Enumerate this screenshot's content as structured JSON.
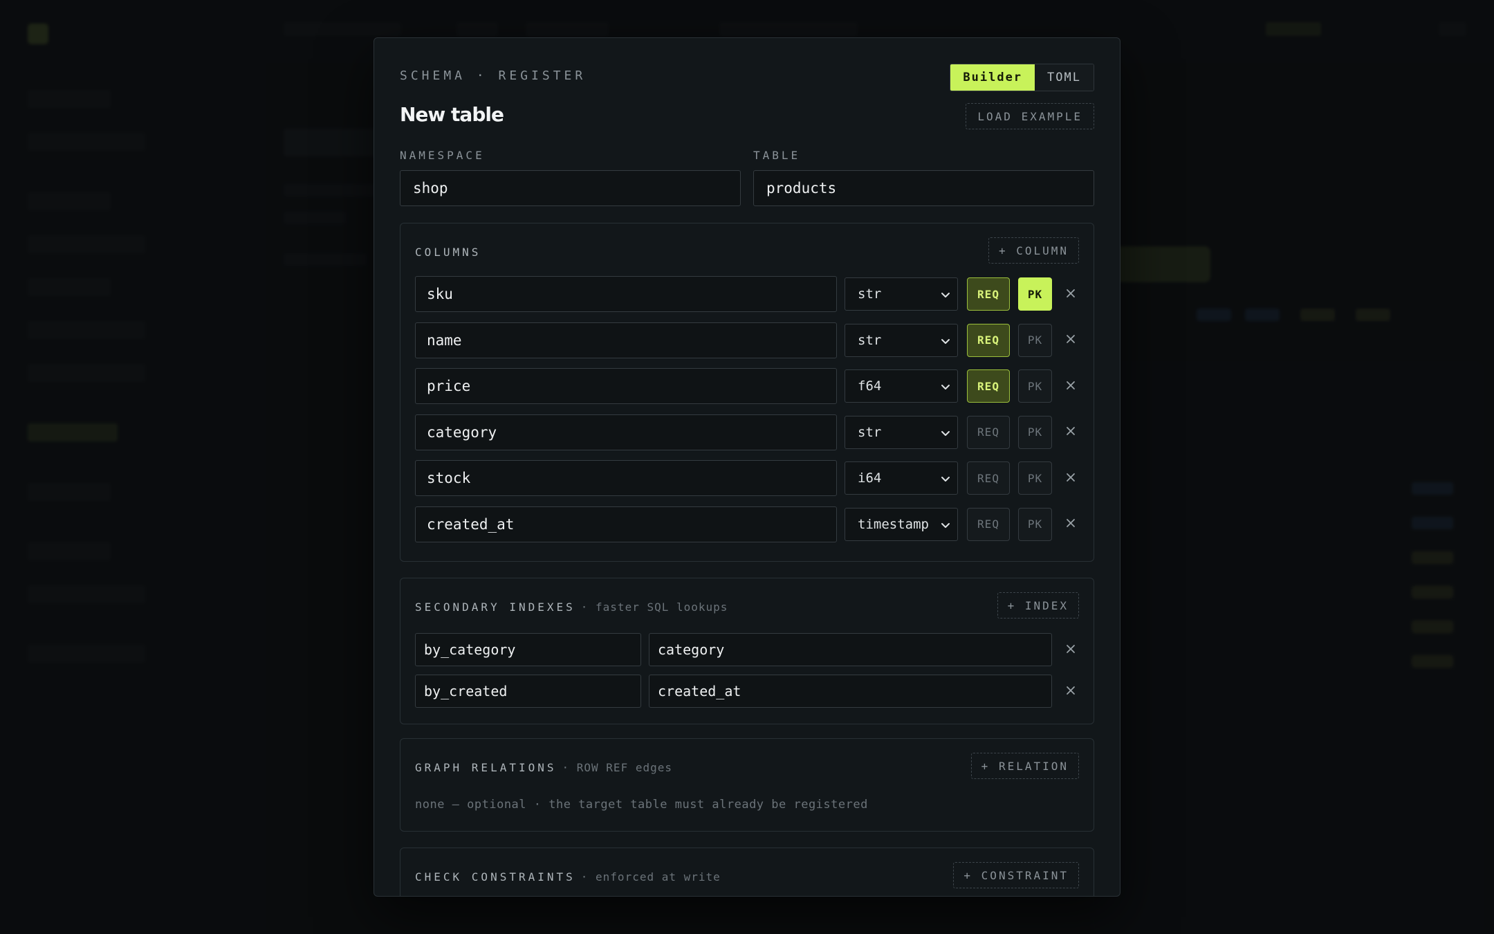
{
  "modal": {
    "eyebrow": "SCHEMA · REGISTER",
    "title": "New table",
    "mode_toggle": {
      "builder": "Builder",
      "toml": "TOML",
      "active": "Builder"
    },
    "load_example": "LOAD EXAMPLE"
  },
  "fields": {
    "namespace": {
      "label": "NAMESPACE",
      "value": "shop"
    },
    "table": {
      "label": "TABLE",
      "value": "products"
    }
  },
  "columns": {
    "heading": "COLUMNS",
    "add_label": "+ COLUMN",
    "req_label": "REQ",
    "pk_label": "PK",
    "rows": [
      {
        "name": "sku",
        "type": "str",
        "required": true,
        "primary_key": true
      },
      {
        "name": "name",
        "type": "str",
        "required": true,
        "primary_key": false
      },
      {
        "name": "price",
        "type": "f64",
        "required": true,
        "primary_key": false
      },
      {
        "name": "category",
        "type": "str",
        "required": false,
        "primary_key": false
      },
      {
        "name": "stock",
        "type": "i64",
        "required": false,
        "primary_key": false
      },
      {
        "name": "created_at",
        "type": "timestamp",
        "required": false,
        "primary_key": false
      }
    ]
  },
  "indexes": {
    "heading": "SECONDARY INDEXES",
    "subheading": "· faster SQL lookups",
    "add_label": "+ INDEX",
    "rows": [
      {
        "name": "by_category",
        "column": "category"
      },
      {
        "name": "by_created",
        "column": "created_at"
      }
    ]
  },
  "relations": {
    "heading": "GRAPH RELATIONS",
    "subheading": "· ROW REF edges",
    "add_label": "+ RELATION",
    "empty_text": "none — optional · the target table must already be registered"
  },
  "constraints": {
    "heading": "CHECK CONSTRAINTS",
    "subheading": "· enforced at write",
    "add_label": "+ CONSTRAINT"
  },
  "colors": {
    "accent": "#c8f25a",
    "panel": "#12171a",
    "border": "#283035"
  }
}
